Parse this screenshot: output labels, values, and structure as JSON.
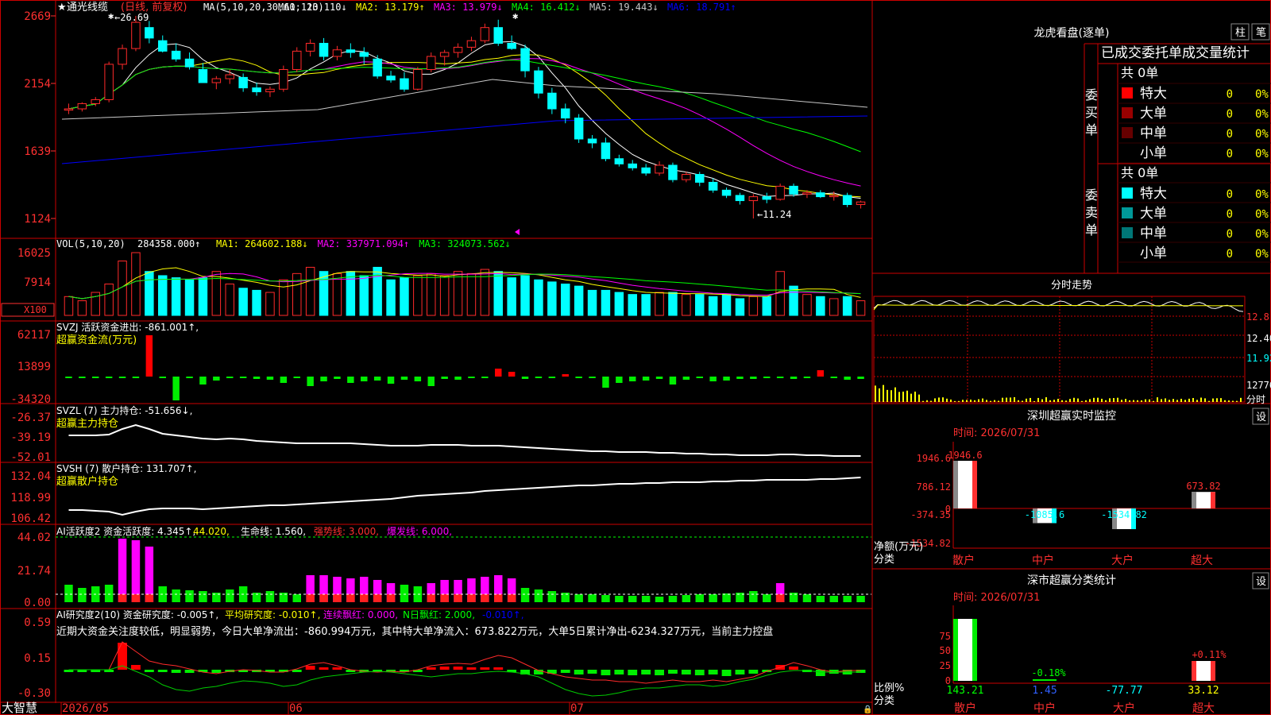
{
  "stock": {
    "name": "通光线缆",
    "star": "★",
    "period_note": "(日线, 前复权)"
  },
  "colors": {
    "up": "#ff2a2a",
    "down": "#00ffff",
    "ma1": "#ffffff",
    "ma2": "#ffff00",
    "ma3": "#ff00ff",
    "ma4": "#00ff00",
    "ma5": "#c8c8c8",
    "ma6": "#0000ff",
    "grid": "#cc0000",
    "axis_text": "#ff3030"
  },
  "price_panel": {
    "ma_title": "MA(5,10,20,30,60,120)",
    "ma_labels": [
      {
        "key": "ma1",
        "text": "MA1: 13.110↓"
      },
      {
        "key": "ma2",
        "text": "MA2: 13.179↑"
      },
      {
        "key": "ma3",
        "text": "MA3: 13.979↓"
      },
      {
        "key": "ma4",
        "text": "MA4: 16.412↓"
      },
      {
        "key": "ma5",
        "text": "MA5: 19.443↓"
      },
      {
        "key": "ma6",
        "text": "MA6: 18.791↑"
      }
    ],
    "y_ticks": [
      "2669",
      "2154",
      "1639",
      "1124"
    ],
    "high_mark": "←26.69",
    "low_mark": "←11.24"
  },
  "vol_panel": {
    "title": "VOL(5,10,20)",
    "vol_value": "284358.000↑",
    "ma_labels": [
      {
        "key": "ma2",
        "text": "MA1: 264602.188↓"
      },
      {
        "key": "ma3",
        "text": "MA2: 337971.094↑"
      },
      {
        "key": "ma4",
        "text": "MA3: 324073.562↓"
      }
    ],
    "y_ticks": [
      "16025",
      "7914"
    ],
    "unit": "X100"
  },
  "svzj_panel": {
    "title": "SVZJ  活跃资金进出: -861.001↑,",
    "subtitle": "超赢资金流(万元)",
    "y_ticks": [
      "62117",
      "13899",
      "-34320"
    ]
  },
  "svzl_panel": {
    "title": "SVZL (7) 主力持仓: -51.656↓,",
    "subtitle": "超赢主力持仓",
    "y_ticks": [
      "-26.37",
      "-39.19",
      "-52.01"
    ]
  },
  "svsh_panel": {
    "title": "SVSH (7) 散户持仓: 131.707↑,",
    "subtitle": "超赢散户持仓",
    "y_ticks": [
      "132.04",
      "118.99",
      "106.42"
    ]
  },
  "ai2_panel": {
    "parts": [
      {
        "text": "AI活跃度2 资金活跃度: 4.345↑,",
        "color": "#ffffff"
      },
      {
        "text": "44.020,",
        "color": "#ffff00"
      },
      {
        "text": "生命线: 1.560,",
        "color": "#ffffff"
      },
      {
        "text": "强势线: 3.000,",
        "color": "#ff3030"
      },
      {
        "text": "爆发线: 6.000,",
        "color": "#ff00ff"
      }
    ],
    "y_ticks": [
      "44.02",
      "21.74",
      "0.00"
    ]
  },
  "research_panel": {
    "parts": [
      {
        "text": "AI研究度2(10) 资金研究度: -0.005↑,",
        "color": "#ffffff"
      },
      {
        "text": "平均研究度: -0.010↑,",
        "color": "#ffff00"
      },
      {
        "text": "连续飘红: 0.000,",
        "color": "#ff00ff"
      },
      {
        "text": "N日飘红: 2.000,",
        "color": "#00ff00"
      },
      {
        "text": "-0.010↑,",
        "color": "#0000ff"
      }
    ],
    "comment": "近期大资金关注度较低，明显弱势，今日大单净流出：-860.994万元，其中特大单净流入：673.822万元，大单5日累计净出-6234.327万元，当前主力控盘",
    "y_ticks": [
      "0.59",
      "0.15",
      "-0.30"
    ]
  },
  "x_axis": {
    "labels": [
      "2026/05",
      "06",
      "07"
    ]
  },
  "bottom_left": {
    "logo": "大智慧"
  },
  "longhu": {
    "title": "龙虎看盘(逐单)",
    "btn_zhu": "柱",
    "btn_bi": "笔",
    "subtitle": "已成交委托单成交量统计",
    "buy": {
      "side_label": "委买单",
      "total": "共 0单",
      "rows": [
        {
          "label": "特大",
          "color": "#ff0000",
          "count": "0",
          "pct": "0%"
        },
        {
          "label": "大单",
          "color": "#990000",
          "count": "0",
          "pct": "0%"
        },
        {
          "label": "中单",
          "color": "#660000",
          "count": "0",
          "pct": "0%"
        },
        {
          "label": "小单",
          "color": "#000000",
          "count": "0",
          "pct": "0%"
        }
      ]
    },
    "sell": {
      "side_label": "委卖单",
      "total": "共 0单",
      "rows": [
        {
          "label": "特大",
          "color": "#00ffff",
          "count": "0",
          "pct": "0%"
        },
        {
          "label": "大单",
          "color": "#009999",
          "count": "0",
          "pct": "0%"
        },
        {
          "label": "中单",
          "color": "#007777",
          "count": "0",
          "pct": "0%"
        },
        {
          "label": "小单",
          "color": "#000000",
          "count": "0",
          "pct": "0%"
        }
      ]
    }
  },
  "intraday": {
    "title": "分时走势",
    "ticks": [
      "12.8",
      "12.40",
      "11.92",
      "12776",
      "分时"
    ]
  },
  "sz_monitor": {
    "title": "深圳超赢实时监控",
    "btn": "设",
    "time": "时间: 2026/07/31",
    "y_ticks": [
      "1946.6",
      "786.12",
      "0",
      "-374.35",
      "-1534.82"
    ],
    "y_label": "净额(万元)",
    "x_label": "分类",
    "categories": [
      "散户",
      "中户",
      "大户",
      "超大"
    ],
    "values": [
      1946.6,
      -1085.6,
      -1534.82,
      673.82
    ],
    "value_labels": [
      "1946.6",
      "-1085.6",
      "-1534.82",
      "673.82"
    ]
  },
  "sz_class": {
    "title": "深市超赢分类统计",
    "btn": "设",
    "time": "时间: 2026/07/31",
    "y_ticks": [
      "75",
      "50",
      "25",
      "0"
    ],
    "y_label": "比例%",
    "x_label": "分类",
    "categories": [
      "散户",
      "中户",
      "大户",
      "超大"
    ],
    "values": [
      143.21,
      1.45,
      -77.77,
      33.12
    ],
    "top_labels": [
      "",
      "-0.18%",
      "",
      "+0.11%"
    ],
    "value_labels": [
      "143.21",
      "1.45",
      "-77.77",
      "33.12"
    ]
  },
  "chart_data": {
    "type": "candlestick",
    "title": "通光线缆 (日线, 前复权)",
    "x_labels": [
      "2026/05",
      "06",
      "07"
    ],
    "ohlc": [
      [
        19.5,
        20.0,
        19.2,
        19.6
      ],
      [
        19.6,
        20.1,
        19.4,
        20.0
      ],
      [
        20.0,
        20.5,
        19.8,
        20.3
      ],
      [
        20.3,
        23.2,
        20.1,
        23.0
      ],
      [
        23.0,
        24.5,
        22.6,
        24.2
      ],
      [
        24.2,
        26.69,
        24.0,
        26.2
      ],
      [
        25.8,
        26.3,
        24.6,
        25.0
      ],
      [
        24.8,
        25.2,
        23.9,
        24.0
      ],
      [
        24.0,
        24.6,
        23.2,
        23.4
      ],
      [
        23.4,
        23.9,
        22.6,
        22.8
      ],
      [
        22.6,
        23.1,
        21.7,
        21.6
      ],
      [
        21.6,
        22.1,
        21.1,
        21.9
      ],
      [
        21.9,
        22.6,
        21.5,
        22.2
      ],
      [
        22.0,
        22.3,
        20.9,
        21.2
      ],
      [
        21.2,
        21.6,
        20.6,
        20.9
      ],
      [
        20.9,
        21.3,
        20.5,
        21.1
      ],
      [
        21.1,
        22.9,
        20.9,
        22.6
      ],
      [
        22.6,
        24.3,
        22.4,
        24.0
      ],
      [
        24.0,
        24.9,
        23.6,
        24.6
      ],
      [
        24.6,
        25.0,
        23.3,
        23.6
      ],
      [
        23.6,
        24.4,
        23.3,
        24.1
      ],
      [
        24.1,
        24.6,
        23.5,
        23.9
      ],
      [
        23.9,
        24.3,
        23.0,
        23.6
      ],
      [
        23.4,
        23.7,
        21.9,
        22.1
      ],
      [
        22.1,
        22.5,
        21.6,
        21.8
      ],
      [
        21.9,
        22.4,
        20.9,
        21.1
      ],
      [
        21.1,
        22.8,
        21.0,
        22.6
      ],
      [
        22.6,
        23.9,
        22.4,
        23.6
      ],
      [
        23.6,
        24.1,
        22.9,
        23.9
      ],
      [
        23.9,
        24.6,
        23.5,
        24.3
      ],
      [
        24.3,
        25.1,
        24.0,
        24.8
      ],
      [
        24.8,
        26.1,
        24.6,
        25.8
      ],
      [
        25.8,
        26.4,
        24.4,
        24.6
      ],
      [
        24.6,
        25.2,
        24.1,
        24.2
      ],
      [
        24.2,
        24.5,
        22.0,
        22.5
      ],
      [
        22.5,
        22.8,
        20.4,
        20.8
      ],
      [
        20.8,
        21.2,
        19.2,
        19.6
      ],
      [
        19.6,
        20.0,
        18.5,
        18.9
      ],
      [
        18.9,
        19.2,
        17.0,
        17.3
      ],
      [
        17.3,
        17.6,
        16.6,
        17.0
      ],
      [
        17.0,
        17.4,
        15.6,
        15.8
      ],
      [
        15.8,
        16.1,
        15.2,
        15.4
      ],
      [
        15.4,
        15.7,
        14.9,
        15.1
      ],
      [
        15.1,
        15.4,
        14.5,
        14.7
      ],
      [
        14.7,
        15.6,
        14.5,
        15.3
      ],
      [
        15.3,
        15.5,
        14.0,
        14.2
      ],
      [
        14.2,
        14.8,
        14.0,
        14.6
      ],
      [
        14.6,
        14.8,
        13.7,
        14.0
      ],
      [
        14.0,
        14.3,
        13.2,
        13.4
      ],
      [
        13.4,
        13.6,
        12.8,
        13.0
      ],
      [
        13.0,
        13.2,
        12.3,
        12.6
      ],
      [
        12.6,
        13.1,
        11.24,
        12.9
      ],
      [
        12.9,
        13.2,
        12.4,
        12.7
      ],
      [
        12.7,
        13.9,
        12.6,
        13.7
      ],
      [
        13.7,
        13.9,
        12.9,
        13.1
      ],
      [
        13.1,
        13.4,
        12.8,
        13.2
      ],
      [
        13.2,
        13.4,
        12.8,
        12.9
      ],
      [
        12.9,
        13.3,
        12.6,
        13.0
      ],
      [
        13.0,
        13.2,
        12.1,
        12.3
      ],
      [
        12.3,
        12.6,
        12.0,
        12.5
      ]
    ],
    "volume": [
      90,
      70,
      110,
      150,
      260,
      300,
      210,
      190,
      180,
      170,
      180,
      210,
      150,
      130,
      120,
      110,
      170,
      200,
      230,
      210,
      200,
      210,
      190,
      230,
      170,
      180,
      190,
      200,
      190,
      210,
      200,
      220,
      210,
      180,
      190,
      170,
      160,
      150,
      140,
      120,
      120,
      110,
      100,
      100,
      110,
      110,
      100,
      100,
      90,
      100,
      80,
      90,
      90,
      210,
      140,
      100,
      90,
      80,
      90,
      70
    ],
    "ylim": [
      11.24,
      26.69
    ]
  }
}
